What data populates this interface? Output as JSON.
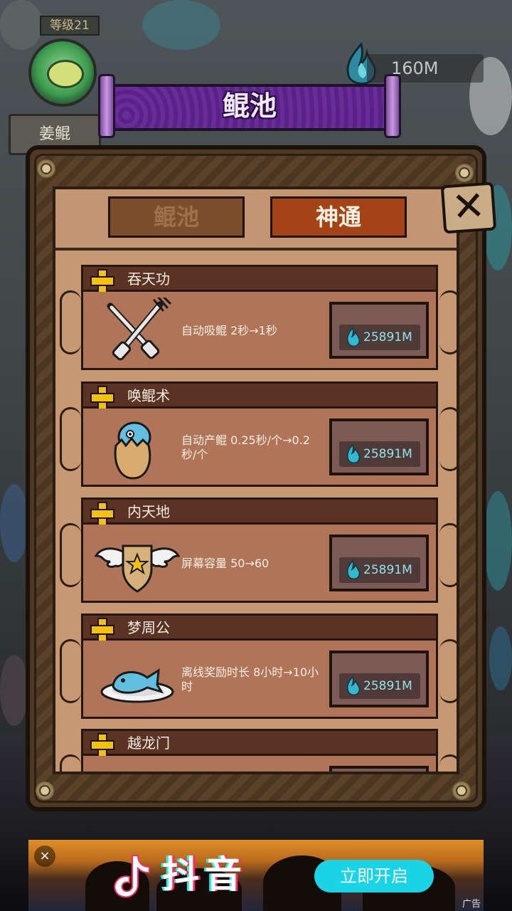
{
  "hud": {
    "level_label": "等级21",
    "name": "姜鲲",
    "currency_value": "160M"
  },
  "panel": {
    "title": "鲲池",
    "tabs": [
      {
        "label": "鲲池",
        "active": false
      },
      {
        "label": "神通",
        "active": true
      }
    ],
    "close_icon": "close-icon",
    "skills": [
      {
        "name": "吞天功",
        "icon": "fork-knife-icon",
        "desc": "自动吸鲲 2秒→1秒",
        "cost": "25891M"
      },
      {
        "name": "唤鲲术",
        "icon": "egg-icon",
        "desc": "自动产鲲 0.25秒/个→0.2秒/个",
        "cost": "25891M"
      },
      {
        "name": "内天地",
        "icon": "winged-shield-icon",
        "desc": "屏幕容量 50→60",
        "cost": "25891M"
      },
      {
        "name": "梦周公",
        "icon": "fish-plate-icon",
        "desc": "离线奖励时长 8小时→10小时",
        "cost": "25891M"
      },
      {
        "name": "越龙门",
        "icon": "",
        "desc": "",
        "cost": ""
      }
    ]
  },
  "ad": {
    "close": "×",
    "brand": "抖音",
    "cta": "立即开启",
    "tag": "广告"
  },
  "colors": {
    "cost_text": "#8fe3ec",
    "plus": "#f4c20c",
    "active_tab": "#a44416",
    "banner": "#6a2c98"
  }
}
